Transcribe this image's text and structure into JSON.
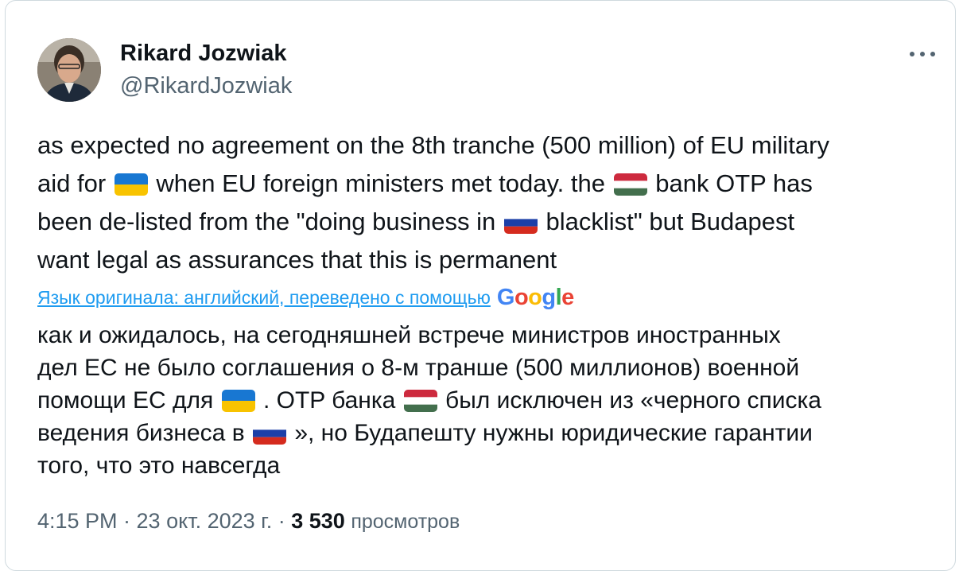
{
  "author": {
    "name": "Rikard Jozwiak",
    "handle": "@RikardJozwiak"
  },
  "tweet": {
    "line1": "as expected no agreement on the 8th tranche (500 million) of EU military",
    "line2_a": "aid for",
    "line2_b": "when EU foreign ministers met today. the",
    "line2_c": "bank OTP has",
    "line3_a": "been de-listed from the \"doing business in",
    "line3_b": "blacklist\" but Budapest",
    "line4": "want legal as assurances that this is permanent"
  },
  "translation": {
    "link_text": "Язык оригинала: английский, переведено с помощью",
    "provider": "Google",
    "line1": "как и ожидалось, на сегодняшней встрече министров иностранных",
    "line2": "дел ЕС не было соглашения о 8-м транше (500 миллионов) военной",
    "line3_a": "помощи ЕС для",
    "line3_b": ". OTP банка",
    "line3_c": "был исключен из «черного списка",
    "line4_a": "ведения бизнеса в",
    "line4_b": "», но Будапешту нужны юридические гарантии",
    "line5": "того, что это навсегда"
  },
  "meta": {
    "time_date": "4:15 PM · 23 окт. 2023 г. ·",
    "views_count": "3 530",
    "views_label": "просмотров"
  },
  "icons": {
    "more": "more-horizontal-icon",
    "flag_ukraine": "flag-ukraine-icon",
    "flag_hungary": "flag-hungary-icon",
    "flag_russia": "flag-russia-icon"
  },
  "colors": {
    "text": "#0f1419",
    "secondary": "#536471",
    "link": "#1d9bf0",
    "border": "#cfd9de",
    "google_blue": "#4285f4",
    "google_red": "#ea4335",
    "google_yellow": "#fbbc05",
    "google_green": "#34a853"
  }
}
